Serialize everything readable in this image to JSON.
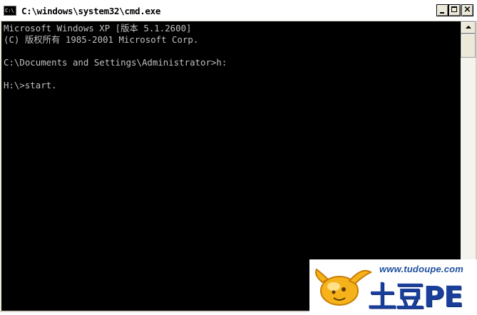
{
  "window": {
    "title": "C:\\windows\\system32\\cmd.exe",
    "icon_label": "C:\\"
  },
  "console": {
    "lines": [
      "Microsoft Windows XP [版本 5.1.2600]",
      "(C) 版权所有 1985-2001 Microsoft Corp.",
      "C:\\Documents and Settings\\Administrator>h:",
      "H:\\>start."
    ],
    "text_color": "#c0c0c0",
    "background": "#000000"
  },
  "watermark": {
    "url": "www.tudoupe.com",
    "logo_text": "土豆PE",
    "brand_color": "#1a3f9a"
  },
  "icons": {
    "window_icon": "cmd-icon",
    "minimize": "minimize-icon",
    "maximize": "maximize-icon",
    "close": "close-icon",
    "scroll_up": "arrow-up-icon",
    "mascot": "potato-mascot-icon"
  }
}
